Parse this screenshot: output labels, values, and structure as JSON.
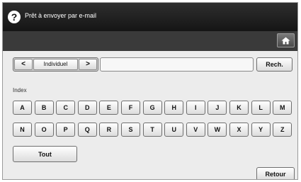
{
  "header": {
    "help_icon": "?",
    "title": "Prêt à envoyer par e-mail",
    "home_icon": "home-icon"
  },
  "toolbar": {
    "prev_arrow": "<",
    "mode_label": "Individuel",
    "next_arrow": ">",
    "search_value": "",
    "search_button": "Rech."
  },
  "index": {
    "label": "Index",
    "row1": [
      "A",
      "B",
      "C",
      "D",
      "E",
      "F",
      "G",
      "H",
      "I",
      "J",
      "K",
      "L",
      "M"
    ],
    "row2": [
      "N",
      "O",
      "P",
      "Q",
      "R",
      "S",
      "T",
      "U",
      "V",
      "W",
      "X",
      "Y",
      "Z"
    ],
    "all_button": "Tout"
  },
  "footer": {
    "back_button": "Retour"
  }
}
